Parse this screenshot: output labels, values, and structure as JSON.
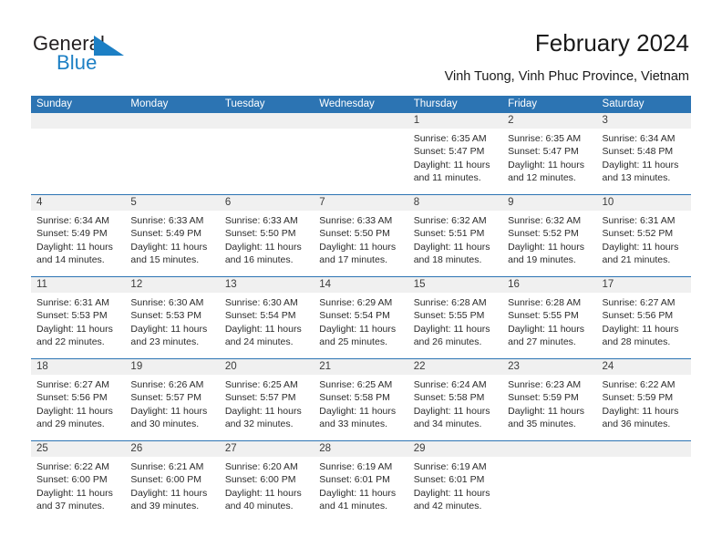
{
  "brand": {
    "word_one": "General",
    "word_two": "Blue",
    "mark": "triangle-icon",
    "accent_color": "#1c7fc4"
  },
  "header": {
    "title": "February 2024",
    "subtitle": "Vinh Tuong, Vinh Phuc Province, Vietnam"
  },
  "theme": {
    "header_blue": "#2c74b3",
    "daynum_band": "#f0f0f0",
    "text": "#2b2b2b"
  },
  "calendar": {
    "weekdays": [
      "Sunday",
      "Monday",
      "Tuesday",
      "Wednesday",
      "Thursday",
      "Friday",
      "Saturday"
    ],
    "weeks": [
      {
        "numbers": [
          "",
          "",
          "",
          "",
          "1",
          "2",
          "3"
        ],
        "cells": [
          {
            "sunrise": "",
            "sunset": "",
            "daylight_1": "",
            "daylight_2": ""
          },
          {
            "sunrise": "",
            "sunset": "",
            "daylight_1": "",
            "daylight_2": ""
          },
          {
            "sunrise": "",
            "sunset": "",
            "daylight_1": "",
            "daylight_2": ""
          },
          {
            "sunrise": "",
            "sunset": "",
            "daylight_1": "",
            "daylight_2": ""
          },
          {
            "sunrise": "Sunrise: 6:35 AM",
            "sunset": "Sunset: 5:47 PM",
            "daylight_1": "Daylight: 11 hours",
            "daylight_2": "and 11 minutes."
          },
          {
            "sunrise": "Sunrise: 6:35 AM",
            "sunset": "Sunset: 5:47 PM",
            "daylight_1": "Daylight: 11 hours",
            "daylight_2": "and 12 minutes."
          },
          {
            "sunrise": "Sunrise: 6:34 AM",
            "sunset": "Sunset: 5:48 PM",
            "daylight_1": "Daylight: 11 hours",
            "daylight_2": "and 13 minutes."
          }
        ]
      },
      {
        "numbers": [
          "4",
          "5",
          "6",
          "7",
          "8",
          "9",
          "10"
        ],
        "cells": [
          {
            "sunrise": "Sunrise: 6:34 AM",
            "sunset": "Sunset: 5:49 PM",
            "daylight_1": "Daylight: 11 hours",
            "daylight_2": "and 14 minutes."
          },
          {
            "sunrise": "Sunrise: 6:33 AM",
            "sunset": "Sunset: 5:49 PM",
            "daylight_1": "Daylight: 11 hours",
            "daylight_2": "and 15 minutes."
          },
          {
            "sunrise": "Sunrise: 6:33 AM",
            "sunset": "Sunset: 5:50 PM",
            "daylight_1": "Daylight: 11 hours",
            "daylight_2": "and 16 minutes."
          },
          {
            "sunrise": "Sunrise: 6:33 AM",
            "sunset": "Sunset: 5:50 PM",
            "daylight_1": "Daylight: 11 hours",
            "daylight_2": "and 17 minutes."
          },
          {
            "sunrise": "Sunrise: 6:32 AM",
            "sunset": "Sunset: 5:51 PM",
            "daylight_1": "Daylight: 11 hours",
            "daylight_2": "and 18 minutes."
          },
          {
            "sunrise": "Sunrise: 6:32 AM",
            "sunset": "Sunset: 5:52 PM",
            "daylight_1": "Daylight: 11 hours",
            "daylight_2": "and 19 minutes."
          },
          {
            "sunrise": "Sunrise: 6:31 AM",
            "sunset": "Sunset: 5:52 PM",
            "daylight_1": "Daylight: 11 hours",
            "daylight_2": "and 21 minutes."
          }
        ]
      },
      {
        "numbers": [
          "11",
          "12",
          "13",
          "14",
          "15",
          "16",
          "17"
        ],
        "cells": [
          {
            "sunrise": "Sunrise: 6:31 AM",
            "sunset": "Sunset: 5:53 PM",
            "daylight_1": "Daylight: 11 hours",
            "daylight_2": "and 22 minutes."
          },
          {
            "sunrise": "Sunrise: 6:30 AM",
            "sunset": "Sunset: 5:53 PM",
            "daylight_1": "Daylight: 11 hours",
            "daylight_2": "and 23 minutes."
          },
          {
            "sunrise": "Sunrise: 6:30 AM",
            "sunset": "Sunset: 5:54 PM",
            "daylight_1": "Daylight: 11 hours",
            "daylight_2": "and 24 minutes."
          },
          {
            "sunrise": "Sunrise: 6:29 AM",
            "sunset": "Sunset: 5:54 PM",
            "daylight_1": "Daylight: 11 hours",
            "daylight_2": "and 25 minutes."
          },
          {
            "sunrise": "Sunrise: 6:28 AM",
            "sunset": "Sunset: 5:55 PM",
            "daylight_1": "Daylight: 11 hours",
            "daylight_2": "and 26 minutes."
          },
          {
            "sunrise": "Sunrise: 6:28 AM",
            "sunset": "Sunset: 5:55 PM",
            "daylight_1": "Daylight: 11 hours",
            "daylight_2": "and 27 minutes."
          },
          {
            "sunrise": "Sunrise: 6:27 AM",
            "sunset": "Sunset: 5:56 PM",
            "daylight_1": "Daylight: 11 hours",
            "daylight_2": "and 28 minutes."
          }
        ]
      },
      {
        "numbers": [
          "18",
          "19",
          "20",
          "21",
          "22",
          "23",
          "24"
        ],
        "cells": [
          {
            "sunrise": "Sunrise: 6:27 AM",
            "sunset": "Sunset: 5:56 PM",
            "daylight_1": "Daylight: 11 hours",
            "daylight_2": "and 29 minutes."
          },
          {
            "sunrise": "Sunrise: 6:26 AM",
            "sunset": "Sunset: 5:57 PM",
            "daylight_1": "Daylight: 11 hours",
            "daylight_2": "and 30 minutes."
          },
          {
            "sunrise": "Sunrise: 6:25 AM",
            "sunset": "Sunset: 5:57 PM",
            "daylight_1": "Daylight: 11 hours",
            "daylight_2": "and 32 minutes."
          },
          {
            "sunrise": "Sunrise: 6:25 AM",
            "sunset": "Sunset: 5:58 PM",
            "daylight_1": "Daylight: 11 hours",
            "daylight_2": "and 33 minutes."
          },
          {
            "sunrise": "Sunrise: 6:24 AM",
            "sunset": "Sunset: 5:58 PM",
            "daylight_1": "Daylight: 11 hours",
            "daylight_2": "and 34 minutes."
          },
          {
            "sunrise": "Sunrise: 6:23 AM",
            "sunset": "Sunset: 5:59 PM",
            "daylight_1": "Daylight: 11 hours",
            "daylight_2": "and 35 minutes."
          },
          {
            "sunrise": "Sunrise: 6:22 AM",
            "sunset": "Sunset: 5:59 PM",
            "daylight_1": "Daylight: 11 hours",
            "daylight_2": "and 36 minutes."
          }
        ]
      },
      {
        "numbers": [
          "25",
          "26",
          "27",
          "28",
          "29",
          "",
          ""
        ],
        "cells": [
          {
            "sunrise": "Sunrise: 6:22 AM",
            "sunset": "Sunset: 6:00 PM",
            "daylight_1": "Daylight: 11 hours",
            "daylight_2": "and 37 minutes."
          },
          {
            "sunrise": "Sunrise: 6:21 AM",
            "sunset": "Sunset: 6:00 PM",
            "daylight_1": "Daylight: 11 hours",
            "daylight_2": "and 39 minutes."
          },
          {
            "sunrise": "Sunrise: 6:20 AM",
            "sunset": "Sunset: 6:00 PM",
            "daylight_1": "Daylight: 11 hours",
            "daylight_2": "and 40 minutes."
          },
          {
            "sunrise": "Sunrise: 6:19 AM",
            "sunset": "Sunset: 6:01 PM",
            "daylight_1": "Daylight: 11 hours",
            "daylight_2": "and 41 minutes."
          },
          {
            "sunrise": "Sunrise: 6:19 AM",
            "sunset": "Sunset: 6:01 PM",
            "daylight_1": "Daylight: 11 hours",
            "daylight_2": "and 42 minutes."
          },
          {
            "sunrise": "",
            "sunset": "",
            "daylight_1": "",
            "daylight_2": ""
          },
          {
            "sunrise": "",
            "sunset": "",
            "daylight_1": "",
            "daylight_2": ""
          }
        ]
      }
    ]
  }
}
